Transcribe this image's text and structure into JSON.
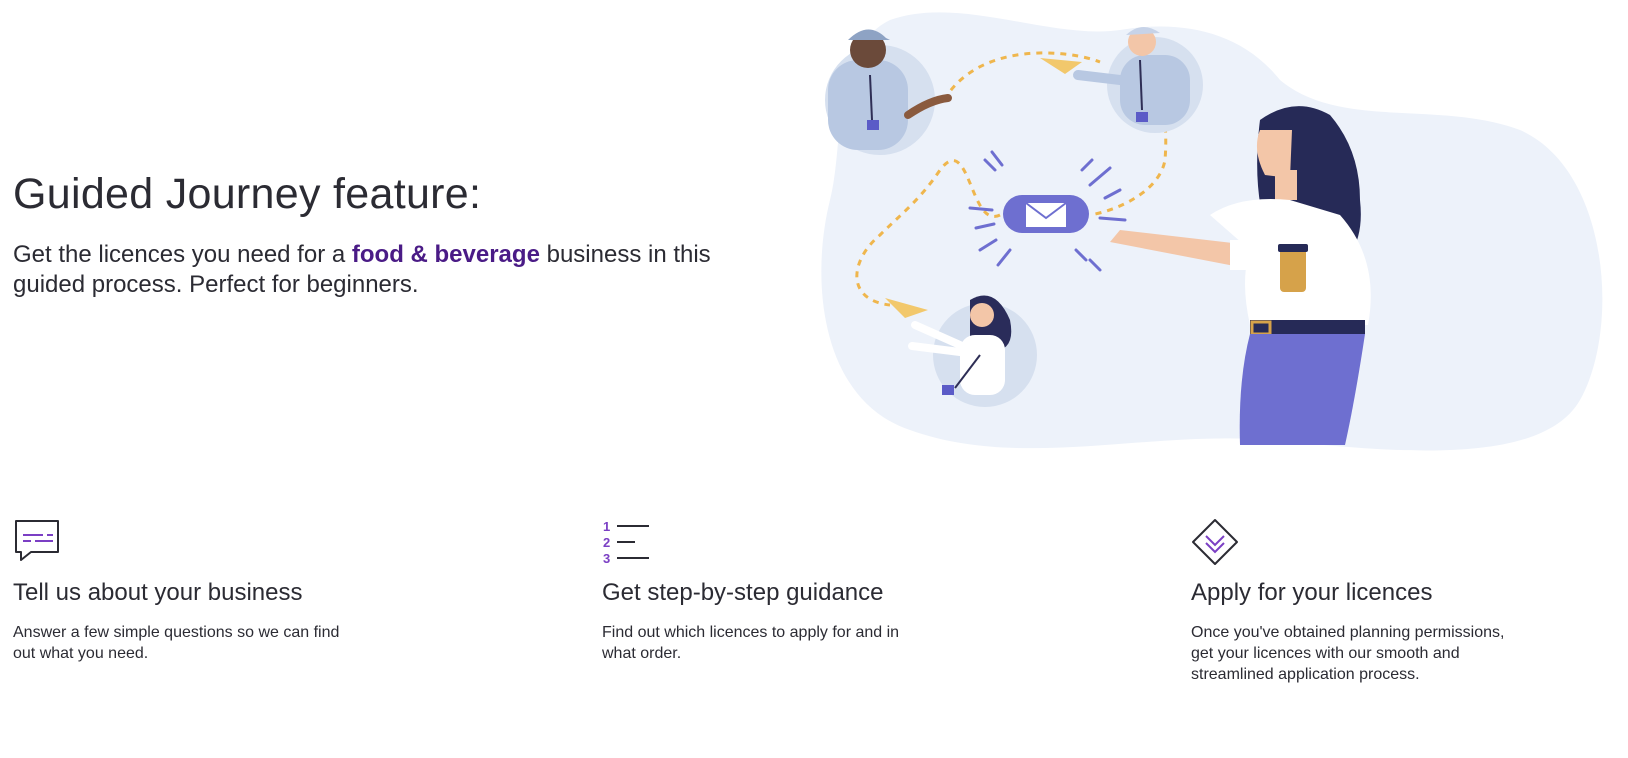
{
  "hero": {
    "title": "Guided Journey feature:",
    "subtitle_before": "Get the licences you need for a ",
    "subtitle_highlight": "food & beverage",
    "subtitle_after": " business in this guided process. Perfect for beginners."
  },
  "features": [
    {
      "icon": "chat-bubble-icon",
      "title": "Tell us about your business",
      "text": "Answer a few simple questions so we can find out what you need."
    },
    {
      "icon": "numbered-list-icon",
      "title": "Get step-by-step guidance",
      "text": "Find out which licences to apply for and in what order."
    },
    {
      "icon": "diamond-chevron-down-icon",
      "title": "Apply for your licences",
      "text": "Once you've obtained planning permissions, get your licences with our smooth and streamlined application process."
    }
  ],
  "list_icon_numbers": [
    "1",
    "2",
    "3"
  ],
  "colors": {
    "highlight": "#4a1b86",
    "accent_purple": "#7b3fc4",
    "blob": "#edf2fa",
    "envelope": "#6e6fd0",
    "dashed_path": "#efb64d",
    "text": "#2b2b33"
  }
}
